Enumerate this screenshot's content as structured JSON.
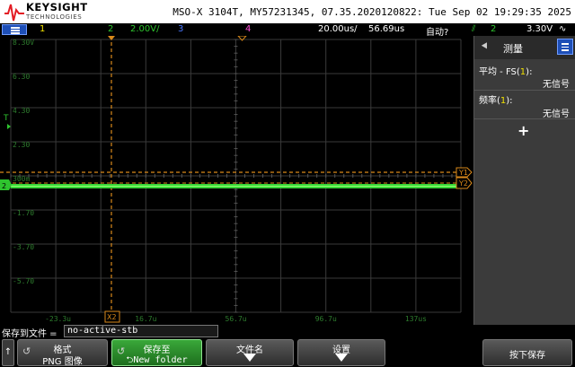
{
  "header": {
    "brand": "KEYSIGHT",
    "brand_sub": "TECHNOLOGIES",
    "device_info": "MSO-X 3104T, MY57231345, 07.35.2020120822: Tue Sep 02 19:29:35 2025"
  },
  "channel_bar": {
    "ch1": "1",
    "ch2": "2",
    "ch2_scale": "2.00V/",
    "ch3": "3",
    "ch4": "4",
    "timebase": "20.00us/",
    "delay": "56.69us",
    "trigger_mode": "自动?",
    "trigger_source": "2",
    "trigger_level": "3.30V",
    "colors": {
      "ch1": "#f0e000",
      "ch2": "#2ec42e",
      "ch3": "#4a78ff",
      "ch4": "#ff4fd8"
    }
  },
  "scope": {
    "y_labels": [
      "8.30V",
      "6.30",
      "4.30",
      "2.30",
      "300m",
      "-1.70",
      "-3.70",
      "-5.70"
    ],
    "x_labels": [
      "-23.3u",
      "16.7u",
      "56.7u",
      "96.7u",
      "137us"
    ],
    "marker_y1": "Y1",
    "marker_y2": "Y2",
    "marker_x2": "X2",
    "marker_ch2": "2",
    "marker_trigger": "T",
    "trace_level_v": 0.3
  },
  "panel": {
    "title": "测量",
    "meas1_label": "平均 - FS",
    "meas1_ch": "1",
    "meas1_value": "无信号",
    "meas2_label": "频率",
    "meas2_ch": "1",
    "meas2_value": "无信号",
    "add": "+"
  },
  "savebar": {
    "label": "保存到文件 =",
    "filename": "no-active-stb"
  },
  "softkeys": {
    "back": "↑",
    "format_l1": "格式",
    "format_l2": "PNG 图像",
    "saveto_l1": "保存至",
    "saveto_l2": "New folder",
    "filename_l1": "文件名",
    "settings_l1": "设置",
    "press_save": "按下保存"
  }
}
